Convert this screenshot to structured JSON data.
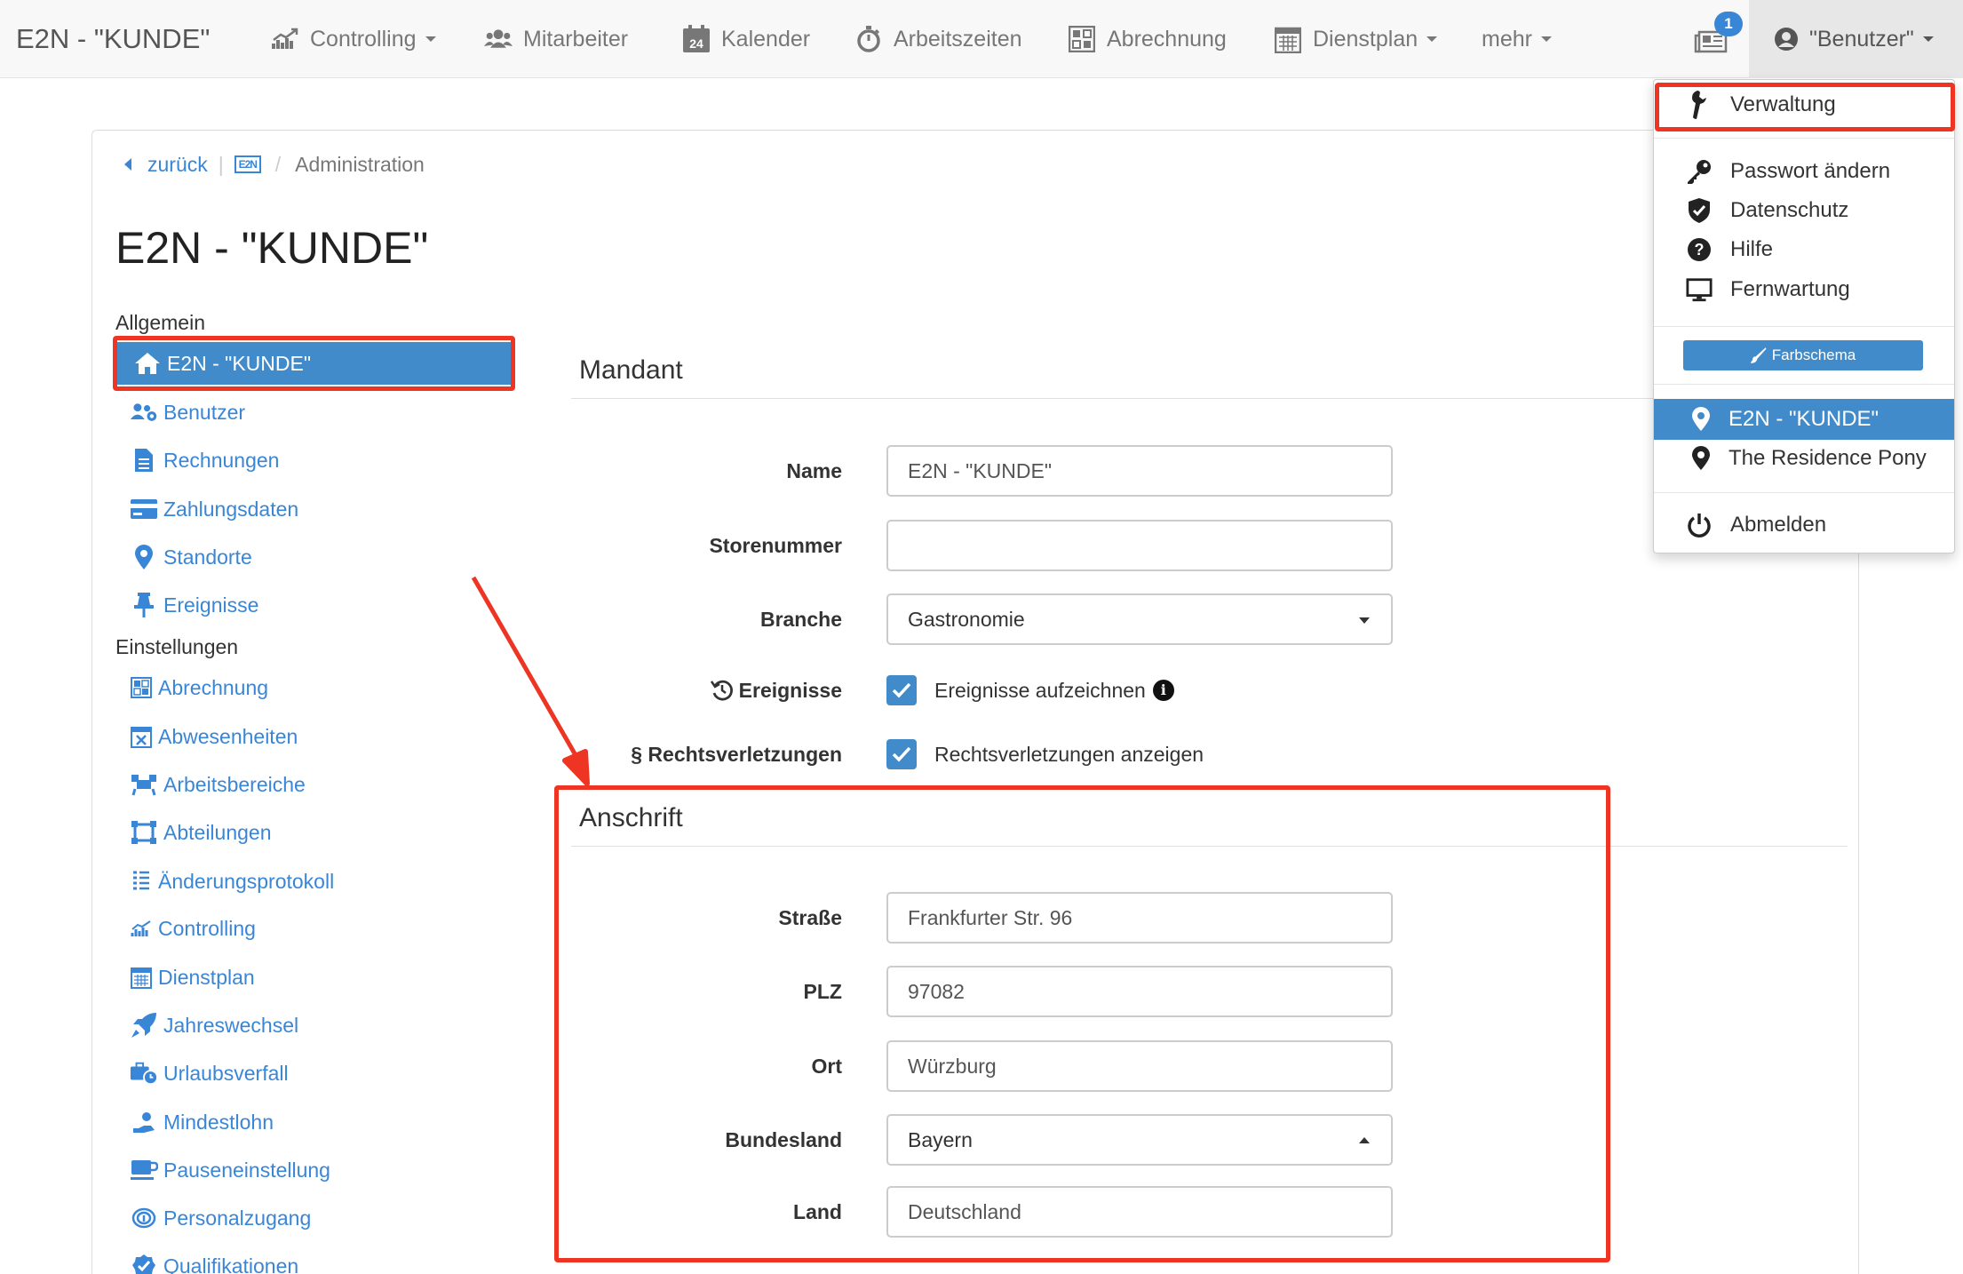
{
  "navbar": {
    "brand": "E2N - \"KUNDE\"",
    "items": [
      {
        "label": "Controlling",
        "icon": "chart-icon",
        "dropdown": true
      },
      {
        "label": "Mitarbeiter",
        "icon": "users-icon",
        "dropdown": false
      },
      {
        "label": "Kalender",
        "icon": "calendar-icon",
        "dropdown": false
      },
      {
        "label": "Arbeitszeiten",
        "icon": "stopwatch-icon",
        "dropdown": false
      },
      {
        "label": "Abrechnung",
        "icon": "billing-icon",
        "dropdown": false
      },
      {
        "label": "Dienstplan",
        "icon": "schedule-icon",
        "dropdown": true
      },
      {
        "label": "mehr",
        "icon": "",
        "dropdown": true
      }
    ],
    "calendar_day": "24",
    "news_badge": "1",
    "user_label": "\"Benutzer\""
  },
  "breadcrumb": {
    "back": "zurück",
    "logo": "E2N",
    "current": "Administration"
  },
  "page_title": "E2N - \"KUNDE\"",
  "sidebar": {
    "sections": [
      {
        "heading": "Allgemein",
        "items": [
          {
            "label": "E2N - \"KUNDE\"",
            "icon": "home-icon",
            "active": true
          },
          {
            "label": "Benutzer",
            "icon": "users-gear-icon"
          },
          {
            "label": "Rechnungen",
            "icon": "document-icon"
          },
          {
            "label": "Zahlungsdaten",
            "icon": "credit-card-icon"
          },
          {
            "label": "Standorte",
            "icon": "map-marker-icon"
          },
          {
            "label": "Ereignisse",
            "icon": "pin-icon"
          }
        ]
      },
      {
        "heading": "Einstellungen",
        "items": [
          {
            "label": "Abrechnung",
            "icon": "billing-icon"
          },
          {
            "label": "Abwesenheiten",
            "icon": "calendar-x-icon"
          },
          {
            "label": "Arbeitsbereiche",
            "icon": "workspace-icon"
          },
          {
            "label": "Abteilungen",
            "icon": "departments-icon"
          },
          {
            "label": "Änderungsprotokoll",
            "icon": "list-icon"
          },
          {
            "label": "Controlling",
            "icon": "chart-icon"
          },
          {
            "label": "Dienstplan",
            "icon": "schedule-icon"
          },
          {
            "label": "Jahreswechsel",
            "icon": "rocket-icon"
          },
          {
            "label": "Urlaubsverfall",
            "icon": "suitcase-clock-icon"
          },
          {
            "label": "Mindestlohn",
            "icon": "hand-coin-icon"
          },
          {
            "label": "Pauseneinstellung",
            "icon": "coffee-icon"
          },
          {
            "label": "Personalzugang",
            "icon": "fingerprint-icon"
          },
          {
            "label": "Qualifikationen",
            "icon": "badge-check-icon"
          }
        ]
      }
    ]
  },
  "mandant": {
    "title": "Mandant",
    "name_label": "Name",
    "name_value": "E2N - \"KUNDE\"",
    "store_label": "Storenummer",
    "store_value": "",
    "branche_label": "Branche",
    "branche_value": "Gastronomie",
    "events_label": "Ereignisse",
    "events_check": "Ereignisse aufzeichnen",
    "events_checked": true,
    "law_label": "§ Rechtsverletzungen",
    "law_check": "Rechtsverletzungen anzeigen",
    "law_checked": true
  },
  "anschrift": {
    "title": "Anschrift",
    "street_label": "Straße",
    "street_value": "Frankfurter Str. 96",
    "plz_label": "PLZ",
    "plz_value": "97082",
    "ort_label": "Ort",
    "ort_value": "Würzburg",
    "state_label": "Bundesland",
    "state_value": "Bayern",
    "country_label": "Land",
    "country_value": "Deutschland"
  },
  "user_dropdown": {
    "admin": "Verwaltung",
    "password": "Passwort ändern",
    "privacy": "Datenschutz",
    "help": "Hilfe",
    "remote": "Fernwartung",
    "color_scheme": "Farbschema",
    "locations": [
      "E2N - \"KUNDE\"",
      "The Residence Pony"
    ],
    "logout": "Abmelden"
  },
  "colors": {
    "accent": "#428bca",
    "link": "#3a86d6",
    "annotation": "#ee3524"
  }
}
